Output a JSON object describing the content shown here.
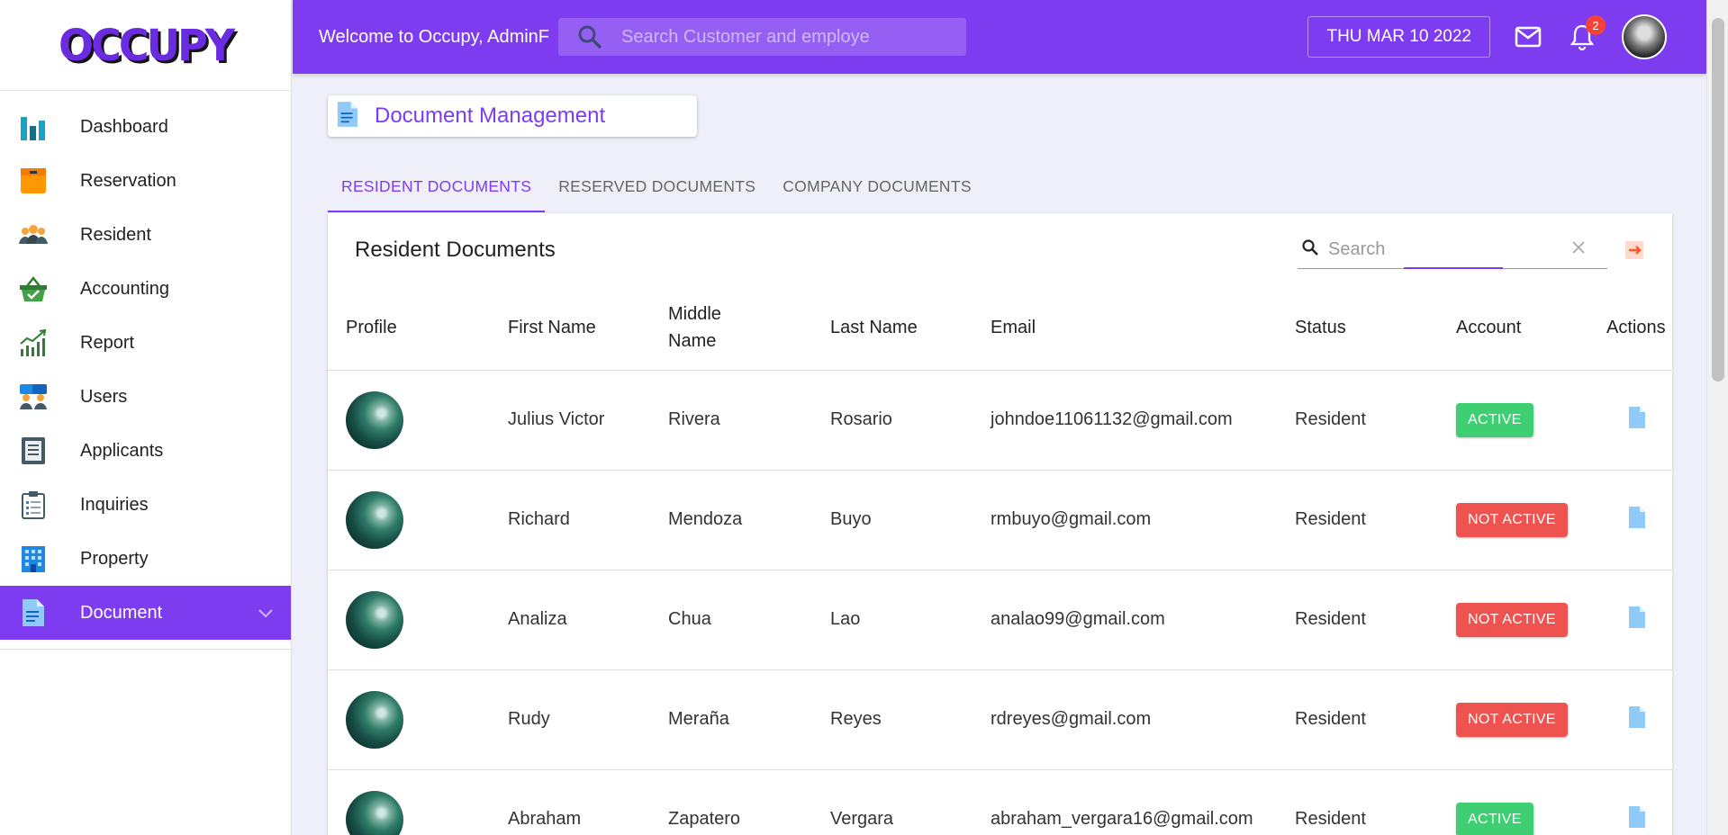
{
  "app": {
    "logo": "OCCUPY"
  },
  "sidebar": {
    "items": [
      {
        "label": "Dashboard",
        "icon": "bar-chart-icon"
      },
      {
        "label": "Reservation",
        "icon": "box-icon"
      },
      {
        "label": "Resident",
        "icon": "people-icon"
      },
      {
        "label": "Accounting",
        "icon": "basket-icon"
      },
      {
        "label": "Report",
        "icon": "growth-chart-icon"
      },
      {
        "label": "Users",
        "icon": "users-icon"
      },
      {
        "label": "Applicants",
        "icon": "clipboard-icon"
      },
      {
        "label": "Inquiries",
        "icon": "checklist-icon"
      },
      {
        "label": "Property",
        "icon": "building-icon"
      },
      {
        "label": "Document",
        "icon": "document-icon",
        "active": true
      }
    ]
  },
  "header": {
    "welcome": "Welcome to Occupy, AdminF",
    "search_placeholder": "Search Customer and employe",
    "date": "THU MAR 10 2022",
    "notification_count": "2"
  },
  "page": {
    "title": "Document Management"
  },
  "tabs": [
    {
      "label": "RESIDENT DOCUMENTS",
      "active": true
    },
    {
      "label": "RESERVED DOCUMENTS"
    },
    {
      "label": "COMPANY DOCUMENTS"
    }
  ],
  "table": {
    "title": "Resident Documents",
    "search_placeholder": "Search",
    "columns": {
      "profile": "Profile",
      "first_name": "First Name",
      "middle_name_1": "Middle",
      "middle_name_2": "Name",
      "last_name": "Last Name",
      "email": "Email",
      "status": "Status",
      "account": "Account",
      "actions": "Actions"
    },
    "rows": [
      {
        "first": "Julius Victor",
        "middle": "Rivera",
        "last": "Rosario",
        "email": "johndoe11061132@gmail.com",
        "status": "Resident",
        "account": "ACTIVE"
      },
      {
        "first": "Richard",
        "middle": "Mendoza",
        "last": "Buyo",
        "email": "rmbuyo@gmail.com",
        "status": "Resident",
        "account": "NOT ACTIVE"
      },
      {
        "first": "Analiza",
        "middle": "Chua",
        "last": "Lao",
        "email": "analao99@gmail.com",
        "status": "Resident",
        "account": "NOT ACTIVE"
      },
      {
        "first": "Rudy",
        "middle": "Meraña",
        "last": "Reyes",
        "email": "rdreyes@gmail.com",
        "status": "Resident",
        "account": "NOT ACTIVE"
      },
      {
        "first": "Abraham",
        "middle": "Zapatero",
        "last": "Vergara",
        "email": "abraham_vergara16@gmail.com",
        "status": "Resident",
        "account": "ACTIVE"
      }
    ]
  },
  "colors": {
    "brand": "#7e3cf1",
    "active": "#3ecf72",
    "inactive": "#ef5350"
  }
}
